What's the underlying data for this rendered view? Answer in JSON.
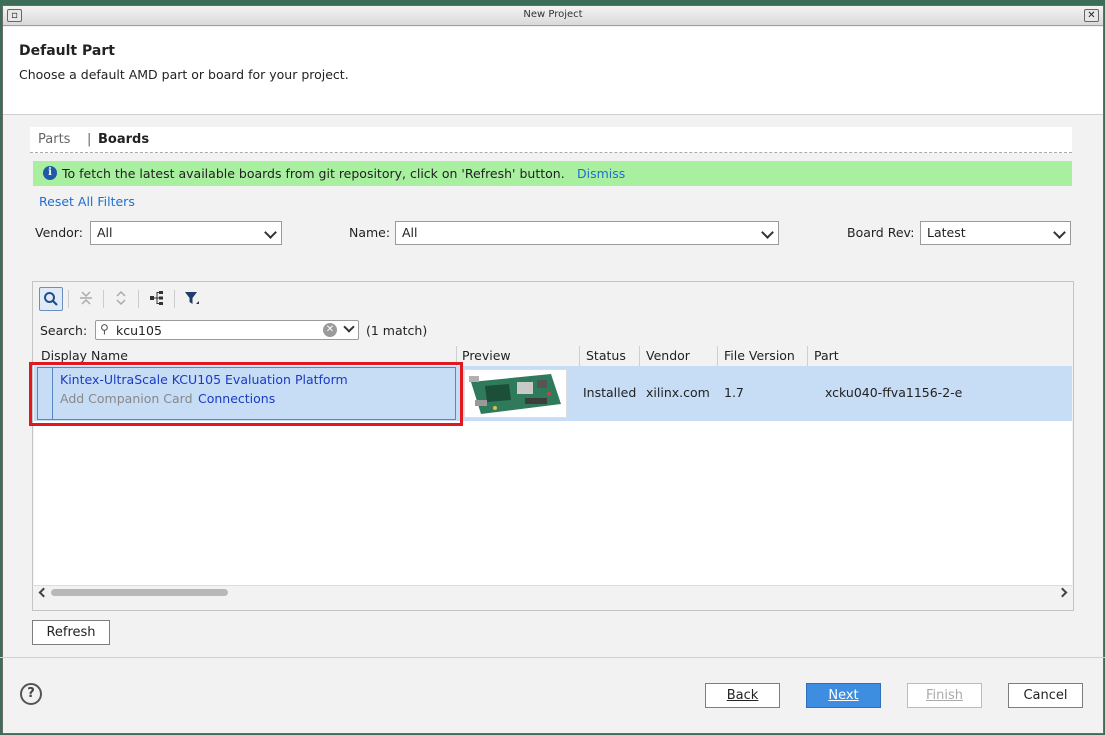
{
  "window": {
    "title": "New Project"
  },
  "header": {
    "title": "Default Part",
    "subtitle": "Choose a default AMD part or board for your project."
  },
  "tabs": [
    {
      "label": "Parts",
      "active": false
    },
    {
      "label": "Boards",
      "active": true
    }
  ],
  "info_bar": {
    "message": "To fetch the latest available boards from git repository, click on 'Refresh' button.",
    "dismiss_label": "Dismiss",
    "color": "#a8f0a0"
  },
  "filters": {
    "reset_label": "Reset All Filters",
    "vendor_label": "Vendor:",
    "vendor_value": "All",
    "name_label": "Name:",
    "name_value": "All",
    "board_rev_label": "Board Rev:",
    "board_rev_value": "Latest"
  },
  "toolbar": {
    "icons": [
      "search-icon",
      "collapse-all-icon",
      "expand-all-icon",
      "hierarchy-icon",
      "filter-icon"
    ]
  },
  "search": {
    "label": "Search:",
    "value": "kcu105",
    "match_text": "(1 match)"
  },
  "table": {
    "columns": [
      "Display Name",
      "Preview",
      "Status",
      "Vendor",
      "File Version",
      "Part"
    ],
    "rows": [
      {
        "display_name": "Kintex-UltraScale KCU105 Evaluation Platform",
        "companion_label": "Add Companion Card",
        "connections_label": "Connections",
        "status": "Installed",
        "vendor": "xilinx.com",
        "file_version": "1.7",
        "part": "xcku040-ffva1156-2-e"
      }
    ]
  },
  "buttons": {
    "refresh": "Refresh",
    "back": "Back",
    "next": "Next",
    "finish": "Finish",
    "cancel": "Cancel",
    "help": "?"
  },
  "colors": {
    "accent": "#3d8ee0",
    "selection": "#c7dcf5",
    "highlight": "#e0181f",
    "link": "#1f6fd1"
  }
}
